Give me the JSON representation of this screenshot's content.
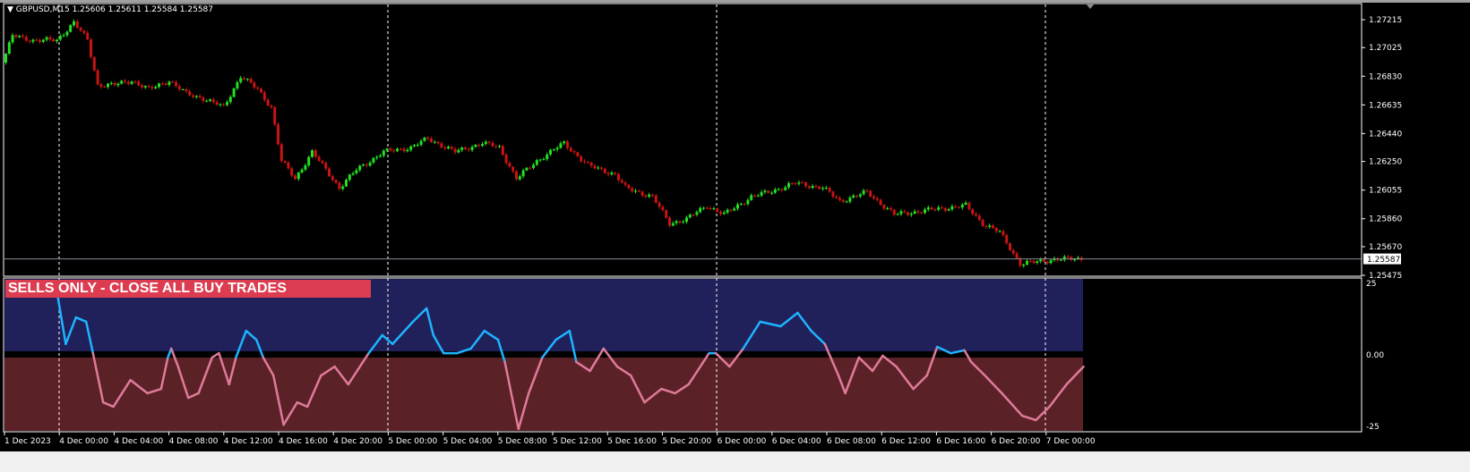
{
  "header": {
    "symbol": "GBPUSD,M15",
    "ohlc": "1.25606 1.25611 1.25584 1.25587"
  },
  "signal_label": "SELLS ONLY - CLOSE ALL BUY TRADES",
  "colors": {
    "bull": "#22e022",
    "bear": "#c81414",
    "osc_pos": "#1eb4ff",
    "osc_neg": "#e07a9a",
    "pos_zone": "#20205a",
    "neg_zone": "#5a2226",
    "signal_bg": "#dc3c50"
  },
  "price_axis": {
    "ticks": [
      "1.27215",
      "1.27025",
      "1.26830",
      "1.26635",
      "1.26440",
      "1.26250",
      "1.26055",
      "1.25860",
      "1.25670",
      "1.25475"
    ],
    "current": "1.25587",
    "min": 1.25475,
    "max": 1.27215
  },
  "osc_axis": {
    "ticks": [
      "25",
      "0.00",
      "-25"
    ],
    "min": -25,
    "max": 25
  },
  "time_axis": [
    "1 Dec 2023",
    "4 Dec 00:00",
    "4 Dec 04:00",
    "4 Dec 08:00",
    "4 Dec 12:00",
    "4 Dec 16:00",
    "4 Dec 20:00",
    "5 Dec 00:00",
    "5 Dec 04:00",
    "5 Dec 08:00",
    "5 Dec 12:00",
    "5 Dec 16:00",
    "5 Dec 20:00",
    "6 Dec 00:00",
    "6 Dec 04:00",
    "6 Dec 08:00",
    "6 Dec 12:00",
    "6 Dec 16:00",
    "6 Dec 20:00",
    "7 Dec 00:00"
  ],
  "chart_data": {
    "type": "line",
    "bars": 317,
    "price_path": [
      [
        0,
        1.26923
      ],
      [
        3,
        1.27105
      ],
      [
        9,
        1.27075
      ],
      [
        16,
        1.27075
      ],
      [
        21,
        1.27197
      ],
      [
        25,
        1.27075
      ],
      [
        28,
        1.26771
      ],
      [
        33,
        1.26771
      ],
      [
        38,
        1.26801
      ],
      [
        43,
        1.2674
      ],
      [
        49,
        1.26801
      ],
      [
        54,
        1.2671
      ],
      [
        59,
        1.2668
      ],
      [
        65,
        1.26619
      ],
      [
        70,
        1.26832
      ],
      [
        75,
        1.2674
      ],
      [
        79,
        1.26619
      ],
      [
        82,
        1.26254
      ],
      [
        86,
        1.26132
      ],
      [
        91,
        1.26315
      ],
      [
        99,
        1.26071
      ],
      [
        104,
        1.26193
      ],
      [
        112,
        1.26315
      ],
      [
        120,
        1.26345
      ],
      [
        125,
        1.26406
      ],
      [
        133,
        1.26315
      ],
      [
        141,
        1.26375
      ],
      [
        146,
        1.26345
      ],
      [
        151,
        1.26132
      ],
      [
        157,
        1.26254
      ],
      [
        165,
        1.26375
      ],
      [
        172,
        1.26223
      ],
      [
        180,
        1.26162
      ],
      [
        183,
        1.26071
      ],
      [
        191,
        1.2601
      ],
      [
        196,
        1.25828
      ],
      [
        201,
        1.25858
      ],
      [
        207,
        1.2595
      ],
      [
        212,
        1.25889
      ],
      [
        220,
        1.2601
      ],
      [
        225,
        1.26041
      ],
      [
        233,
        1.26102
      ],
      [
        241,
        1.26071
      ],
      [
        246,
        1.2598
      ],
      [
        254,
        1.26041
      ],
      [
        262,
        1.25889
      ],
      [
        272,
        1.25919
      ],
      [
        283,
        1.2595
      ],
      [
        288,
        1.25828
      ],
      [
        293,
        1.25767
      ],
      [
        299,
        1.25554
      ],
      [
        304,
        1.25566
      ],
      [
        309,
        1.25585
      ],
      [
        317,
        1.25587
      ]
    ],
    "oscillator": [
      [
        7,
        25
      ],
      [
        9,
        24.1
      ],
      [
        13,
        25
      ],
      [
        15,
        25
      ],
      [
        18,
        3.8
      ],
      [
        21,
        13.1
      ],
      [
        24,
        11.6
      ],
      [
        26,
        0.6
      ],
      [
        29,
        -16.6
      ],
      [
        32,
        -18.1
      ],
      [
        37,
        -8.8
      ],
      [
        42,
        -13.4
      ],
      [
        46,
        -11.9
      ],
      [
        48,
        -0.9
      ],
      [
        49,
        2.2
      ],
      [
        51,
        -4.1
      ],
      [
        54,
        -15
      ],
      [
        57,
        -13.4
      ],
      [
        61,
        -0.9
      ],
      [
        63,
        0.6
      ],
      [
        66,
        -10.3
      ],
      [
        68,
        -0.9
      ],
      [
        71,
        8.4
      ],
      [
        74,
        5.3
      ],
      [
        76,
        -0.9
      ],
      [
        79,
        -7.2
      ],
      [
        82,
        -24.4
      ],
      [
        86,
        -16.6
      ],
      [
        89,
        -18.1
      ],
      [
        93,
        -7.2
      ],
      [
        97,
        -4.1
      ],
      [
        101,
        -10.3
      ],
      [
        107,
        0.6
      ],
      [
        111,
        6.9
      ],
      [
        114,
        3.8
      ],
      [
        120,
        11.6
      ],
      [
        124,
        16.3
      ],
      [
        126,
        6.9
      ],
      [
        129,
        0.6
      ],
      [
        133,
        0.6
      ],
      [
        137,
        2.2
      ],
      [
        141,
        8.4
      ],
      [
        145,
        5.3
      ],
      [
        147,
        -2.5
      ],
      [
        151,
        -25.9
      ],
      [
        154,
        -13.4
      ],
      [
        158,
        -0.9
      ],
      [
        162,
        5.3
      ],
      [
        166,
        8.4
      ],
      [
        168,
        -2.5
      ],
      [
        172,
        -5.6
      ],
      [
        176,
        2.2
      ],
      [
        180,
        -4.1
      ],
      [
        184,
        -7.2
      ],
      [
        188,
        -16.6
      ],
      [
        193,
        -11.9
      ],
      [
        197,
        -13.4
      ],
      [
        201,
        -10.3
      ],
      [
        207,
        0.6
      ],
      [
        209,
        0.6
      ],
      [
        213,
        -4.1
      ],
      [
        217,
        2.2
      ],
      [
        222,
        11.6
      ],
      [
        228,
        10
      ],
      [
        233,
        14.7
      ],
      [
        237,
        8.4
      ],
      [
        241,
        3.8
      ],
      [
        245,
        -7.2
      ],
      [
        247,
        -13.4
      ],
      [
        251,
        -0.9
      ],
      [
        255,
        -5.6
      ],
      [
        258,
        -0.3
      ],
      [
        262,
        -4.1
      ],
      [
        267,
        -11.9
      ],
      [
        271,
        -7.2
      ],
      [
        274,
        2.8
      ],
      [
        278,
        0.6
      ],
      [
        282,
        1.6
      ],
      [
        284,
        -2.5
      ],
      [
        288,
        -7.2
      ],
      [
        293,
        -13.4
      ],
      [
        299,
        -21.3
      ],
      [
        303,
        -22.8
      ],
      [
        307,
        -18.1
      ],
      [
        312,
        -10.3
      ],
      [
        317,
        -4.1
      ]
    ]
  }
}
